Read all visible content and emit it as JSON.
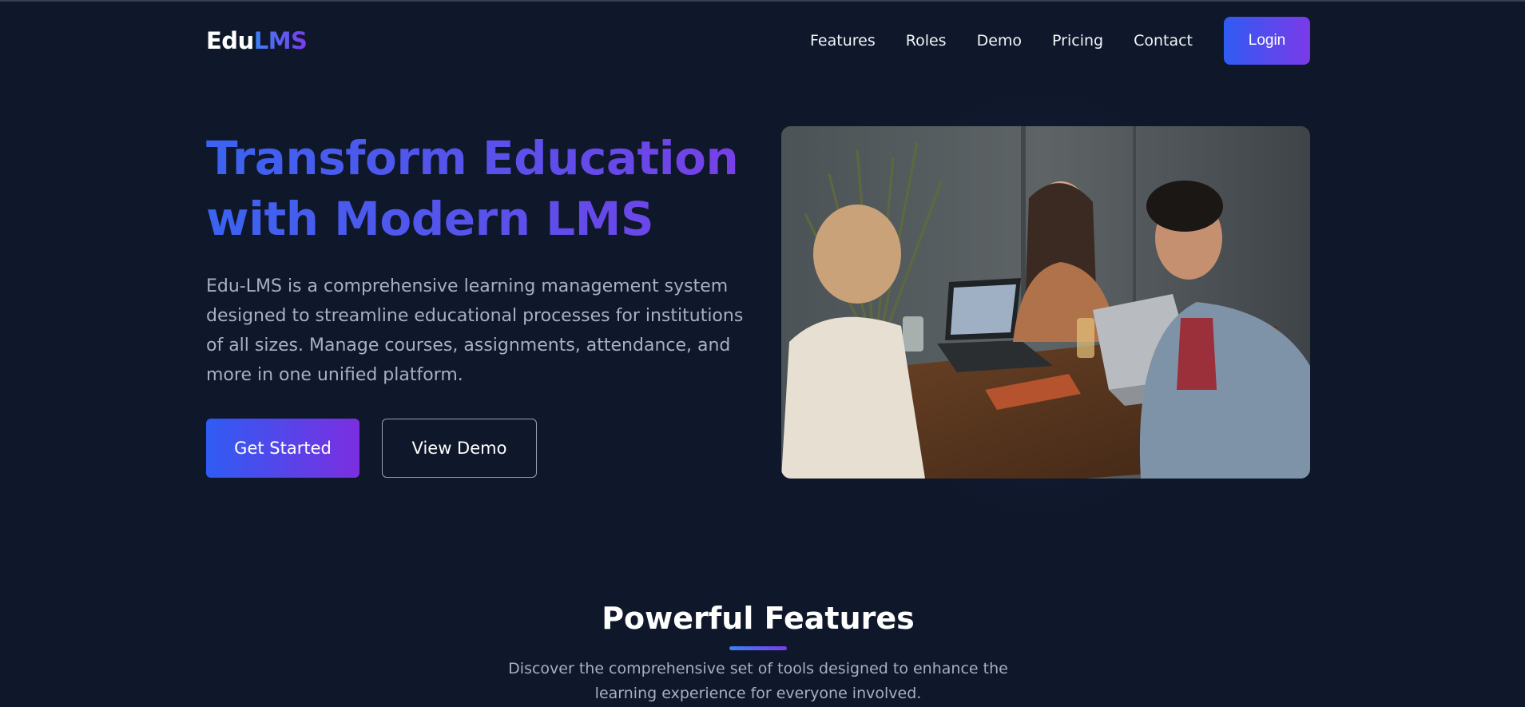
{
  "brand": {
    "name_prefix": "Edu",
    "name_suffix": "LMS"
  },
  "nav": {
    "links": [
      "Features",
      "Roles",
      "Demo",
      "Pricing",
      "Contact"
    ],
    "login_label": "Login"
  },
  "hero": {
    "title_line1": "Transform Education",
    "title_line2": "with Modern LMS",
    "description": "Edu-LMS is a comprehensive learning management system designed to streamline educational processes for institutions of all sizes. Manage courses, assignments, attendance, and more in one unified platform.",
    "primary_cta": "Get Started",
    "secondary_cta": "View Demo"
  },
  "features": {
    "title": "Powerful Features",
    "description": "Discover the comprehensive set of tools designed to enhance the learning experience for everyone involved."
  },
  "colors": {
    "background": "#0f172a",
    "accent_start": "#2f5cf3",
    "accent_end": "#7b3ae8"
  }
}
